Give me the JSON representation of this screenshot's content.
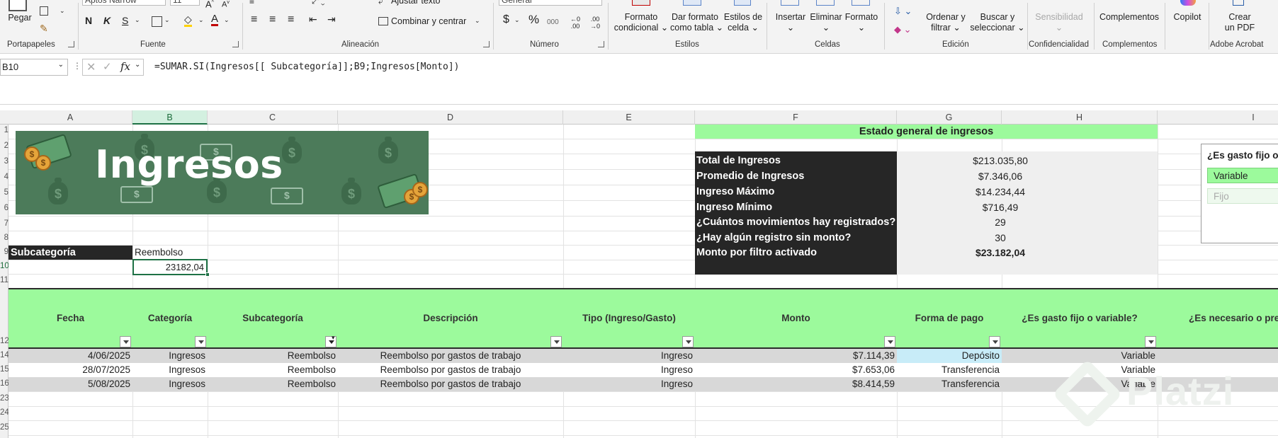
{
  "ribbon": {
    "clipboard": {
      "paste": "Pegar",
      "group": "Portapapeles"
    },
    "font": {
      "name": "Aptos Narrow",
      "size": "11",
      "bold": "N",
      "italic": "K",
      "underline": "S",
      "group": "Fuente"
    },
    "alignment": {
      "wrap": "Ajustar texto",
      "merge": "Combinar y centrar",
      "group": "Alineación"
    },
    "number": {
      "format": "General",
      "currency": "$",
      "percent": "%",
      "thousands": "000",
      "dec_inc": "←0 .00",
      "dec_dec": ".00 →0",
      "group": "Número"
    },
    "styles": {
      "conditional": [
        "Formato",
        "condicional"
      ],
      "as_table": [
        "Dar formato",
        "como tabla"
      ],
      "cell_styles": [
        "Estilos de",
        "celda"
      ],
      "group": "Estilos"
    },
    "cells": {
      "insert": "Insertar",
      "delete": "Eliminar",
      "format": "Formato",
      "group": "Celdas"
    },
    "editing": {
      "sort": [
        "Ordenar y",
        "filtrar"
      ],
      "find": [
        "Buscar y",
        "seleccionar"
      ],
      "group": "Edición"
    },
    "sensitivity": {
      "label": "Sensibilidad",
      "group": "Confidencialidad"
    },
    "addins": {
      "label": "Complementos",
      "group": "Complementos"
    },
    "copilot": {
      "label": "Copilot"
    },
    "acrobat": {
      "label": [
        "Crear",
        "un PDF"
      ],
      "group": "Adobe Acrobat"
    }
  },
  "formula_bar": {
    "name_box": "B10",
    "fx": "fx",
    "formula": "=SUMAR.SI(Ingresos[[ Subcategoría]];B9;Ingresos[Monto])"
  },
  "columns": [
    "A",
    "B",
    "C",
    "D",
    "E",
    "F",
    "G",
    "H",
    "I"
  ],
  "rows": [
    "1",
    "2",
    "3",
    "4",
    "5",
    "6",
    "7",
    "8",
    "9",
    "10",
    "11",
    "12",
    "14",
    "15",
    "16",
    "23",
    "24",
    "25"
  ],
  "banner": {
    "title": "Ingresos"
  },
  "summary": {
    "title": "Estado general de ingresos",
    "items": [
      {
        "label": "Total de Ingresos",
        "value": "$213.035,80"
      },
      {
        "label": "Promedio de Ingresos",
        "value": "$7.346,06"
      },
      {
        "label": "Ingreso Máximo",
        "value": "$14.234,44"
      },
      {
        "label": "Ingreso Mínimo",
        "value": "$716,49"
      },
      {
        "label": "¿Cuántos movimientos hay registrados?",
        "value": "29"
      },
      {
        "label": "¿Hay algún registro sin monto?",
        "value": "30"
      },
      {
        "label": "Monto por filtro activado",
        "value": "$23.182,04"
      }
    ]
  },
  "slicer": {
    "title": "¿Es gasto fijo o v",
    "items": [
      "Variable",
      "Fijo"
    ]
  },
  "subcategory_filter": {
    "label": "Subcategoría",
    "value": "Reembolso",
    "result": "23182,04"
  },
  "table": {
    "headers": [
      "Fecha",
      "Categoría",
      "Subcategoría",
      "Descripción",
      "Tipo (Ingreso/Gasto)",
      "Monto",
      "Forma de pago",
      "¿Es gasto fijo o variable?",
      "¿Es necesario o pres"
    ],
    "rows": [
      [
        "4/06/2025",
        "Ingresos",
        "Reembolso",
        "Reembolso por gastos de trabajo",
        "Ingreso",
        "$7.114,39",
        "Depósito",
        "Variable"
      ],
      [
        "28/07/2025",
        "Ingresos",
        "Reembolso",
        "Reembolso por gastos de trabajo",
        "Ingreso",
        "$7.653,06",
        "Transferencia",
        "Variable"
      ],
      [
        "5/08/2025",
        "Ingresos",
        "Reembolso",
        "Reembolso por gastos de trabajo",
        "Ingreso",
        "$8.414,59",
        "Transferencia",
        "Variable"
      ]
    ]
  },
  "watermark": "Platzi",
  "colors": {
    "accent_green": "#9cfa9c",
    "banner_green": "#4c7b5a",
    "dark_label": "#262626",
    "excel_green": "#1e7145"
  }
}
